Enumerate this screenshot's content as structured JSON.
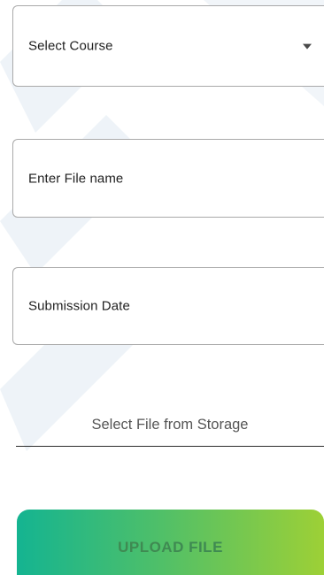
{
  "form": {
    "course_select": {
      "label": "Select Course",
      "icon": "chevron-down-icon"
    },
    "file_name": {
      "placeholder": "Enter File name"
    },
    "submission_date": {
      "placeholder": "Submission Date"
    },
    "select_file_link": "Select File from Storage",
    "upload_button": "UPLOAD FILE"
  },
  "colors": {
    "button_gradient_start": "#14b491",
    "button_gradient_end": "#9dd036",
    "button_text": "#3f8a52",
    "field_border": "#a9a9a9"
  }
}
